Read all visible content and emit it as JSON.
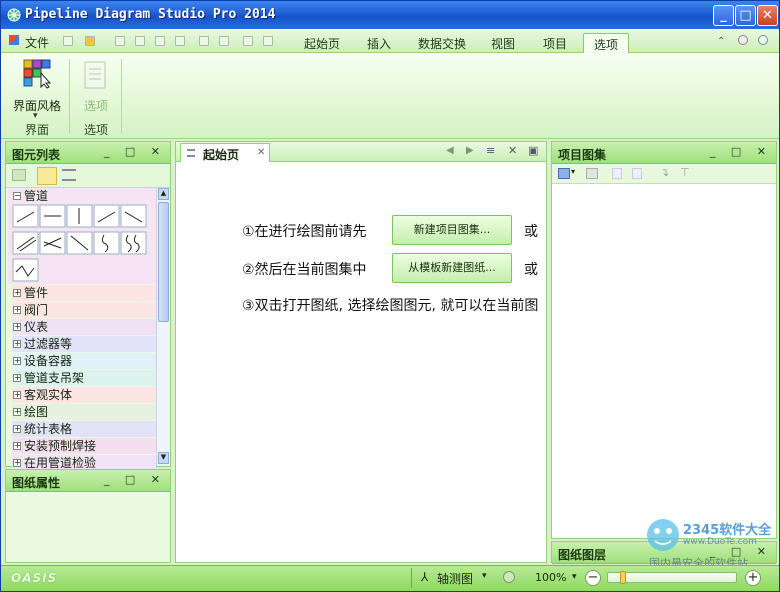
{
  "window": {
    "title": "Pipeline Diagram Studio Pro 2014",
    "min": "_",
    "max": "□",
    "close": "✕"
  },
  "menubar": {
    "file": "文件",
    "tabs": [
      "起始页",
      "插入",
      "数据交换",
      "视图",
      "项目",
      "选项"
    ],
    "active_tab": "选项"
  },
  "ribbon": {
    "style_button": "界面风格",
    "style_dropdown": "▾",
    "options_button": "选项",
    "groups": [
      "界面",
      "选项"
    ]
  },
  "left_panel": {
    "title": "图元列表",
    "ctrls": "_ □ ✕",
    "tree": [
      {
        "label": "管道",
        "expanded": true,
        "color": "#f3d9f2"
      },
      {
        "label": "管件",
        "color": "#fde5e5"
      },
      {
        "label": "阀门",
        "color": "#fbe6e3"
      },
      {
        "label": "仪表",
        "color": "#efe2f7"
      },
      {
        "label": "过滤器等",
        "color": "#e2e3f8"
      },
      {
        "label": "设备容器",
        "color": "#e2f0f8"
      },
      {
        "label": "管道支吊架",
        "color": "#dcf3ef"
      },
      {
        "label": "客观实体",
        "color": "#fde5e5"
      },
      {
        "label": "绘图",
        "color": "#e6f2df"
      },
      {
        "label": "统计表格",
        "color": "#e2e3f8"
      },
      {
        "label": "安装预制焊接",
        "color": "#f6def1"
      },
      {
        "label": "在用管道检验",
        "color": "#f0e3f5"
      }
    ],
    "expand_sign": "+",
    "collapse_sign": "−"
  },
  "props_panel": {
    "title": "图纸属性",
    "ctrls": "_ □ ✕"
  },
  "doc_tab": {
    "label": "起始页",
    "close": "✕"
  },
  "start_page": {
    "line1": "①在进行绘图前请先",
    "btn1": "新建项目图集...",
    "or1": "或",
    "line2": "②然后在当前图集中",
    "btn2": "从模板新建图纸...",
    "or2": "或",
    "line3": "③双击打开图纸, 选择绘图图元, 就可以在当前图"
  },
  "right_panel": {
    "title": "项目图集",
    "ctrls": "_ □ ✕"
  },
  "layers_panel": {
    "title": "图纸图层",
    "ctrls": "_ □ ✕"
  },
  "statusbar": {
    "logo": "OASIS",
    "view_mode": "轴测图",
    "zoom": "100%",
    "minus": "−",
    "plus": "+",
    "zoom_level": 0.1
  },
  "watermark": {
    "brand": "2345软件大全",
    "url": "www.DuoTe.com",
    "slogan": "国内最安全的软件站"
  },
  "colors": {
    "accent": "#9ee07a",
    "title_blue": "#1f5fd6"
  }
}
